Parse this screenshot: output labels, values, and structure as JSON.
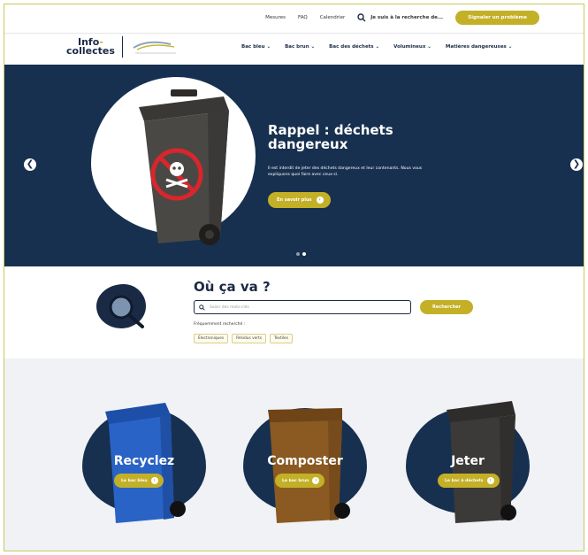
{
  "utility": {
    "links": [
      "Mesures",
      "FAQ",
      "Calendrier"
    ],
    "search_label": "Je suis à la recherche de...",
    "report_button": "Signaler un problème"
  },
  "logo": {
    "line1": "Info",
    "line1_accent": "-",
    "line2": "collectes"
  },
  "nav": {
    "items": [
      "Bac bleu ⌄",
      "Bac brun ⌄",
      "Bac des déchets ⌄",
      "Volumineux ⌄",
      "Matières dangereuses ⌄"
    ]
  },
  "hero": {
    "title": "Rappel : déchets dangereux",
    "text": "Il est interdit de jeter des déchets dangereux et leur contenants. Nous vous expliquons quoi faire avec ceux-ci.",
    "button": "En savoir plus",
    "prev_arrow": "❮",
    "next_arrow": "❯",
    "slides": 2,
    "active_slide": 2
  },
  "search": {
    "title": "Où ça va ?",
    "placeholder": "Saisir des mots-clés",
    "button": "Rechercher",
    "frequent_label": "Fréquemment recherché :",
    "chips": [
      "Électroniques",
      "Résidus verts",
      "Textiles"
    ]
  },
  "bins": [
    {
      "label": "Recyclez",
      "button": "Le bac bleu",
      "color": "#2a63c6"
    },
    {
      "label": "Composter",
      "button": "Le bac brun",
      "color": "#8a5a22"
    },
    {
      "label": "Jeter",
      "button": "Le bac à déchets",
      "color": "#3b3a38"
    }
  ],
  "colors": {
    "navy": "#17304f",
    "gold": "#c3b027"
  }
}
